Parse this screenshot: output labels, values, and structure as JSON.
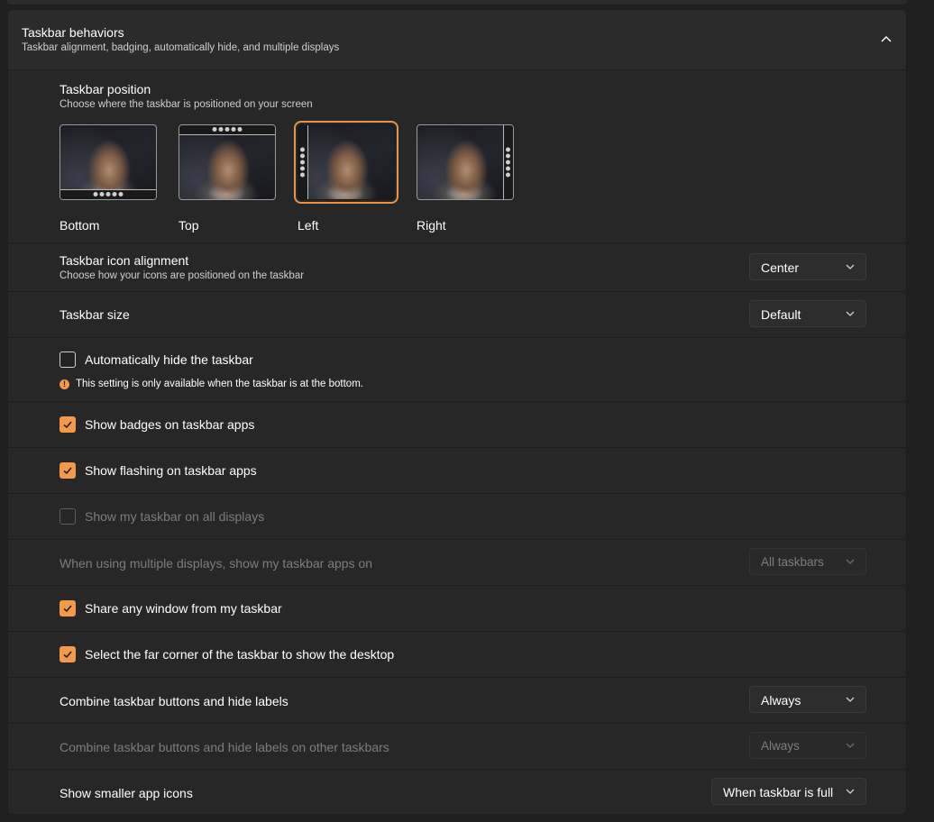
{
  "section": {
    "title": "Taskbar behaviors",
    "subtitle": "Taskbar alignment, badging, automatically hide, and multiple displays"
  },
  "position": {
    "title": "Taskbar position",
    "description": "Choose where the taskbar is positioned on your screen",
    "options": [
      {
        "label": "Bottom"
      },
      {
        "label": "Top"
      },
      {
        "label": "Left"
      },
      {
        "label": "Right"
      }
    ],
    "selected": "Left"
  },
  "alignment": {
    "title": "Taskbar icon alignment",
    "description": "Choose how your icons are positioned on the taskbar",
    "value": "Center"
  },
  "size": {
    "title": "Taskbar size",
    "value": "Default"
  },
  "autohide": {
    "label": "Automatically hide the taskbar",
    "checked": false,
    "warning": "This setting is only available when the taskbar is at the bottom.",
    "warning_icon": "!"
  },
  "badges": {
    "label": "Show badges on taskbar apps",
    "checked": true
  },
  "flashing": {
    "label": "Show flashing on taskbar apps",
    "checked": true
  },
  "all_displays": {
    "label": "Show my taskbar on all displays",
    "checked": false,
    "disabled": true
  },
  "multi_display": {
    "label": "When using multiple displays, show my taskbar apps on",
    "value": "All taskbars",
    "disabled": true
  },
  "share_window": {
    "label": "Share any window from my taskbar",
    "checked": true
  },
  "far_corner": {
    "label": "Select the far corner of the taskbar to show the desktop",
    "checked": true
  },
  "combine": {
    "label": "Combine taskbar buttons and hide labels",
    "value": "Always"
  },
  "combine_other": {
    "label": "Combine taskbar buttons and hide labels on other taskbars",
    "value": "Always",
    "disabled": true
  },
  "smaller_icons": {
    "label": "Show smaller app icons",
    "value": "When taskbar is full"
  },
  "colors": {
    "accent": "#f2994a",
    "background": "#202020",
    "card": "#272727",
    "disabled_text": "#7d7d7d"
  }
}
